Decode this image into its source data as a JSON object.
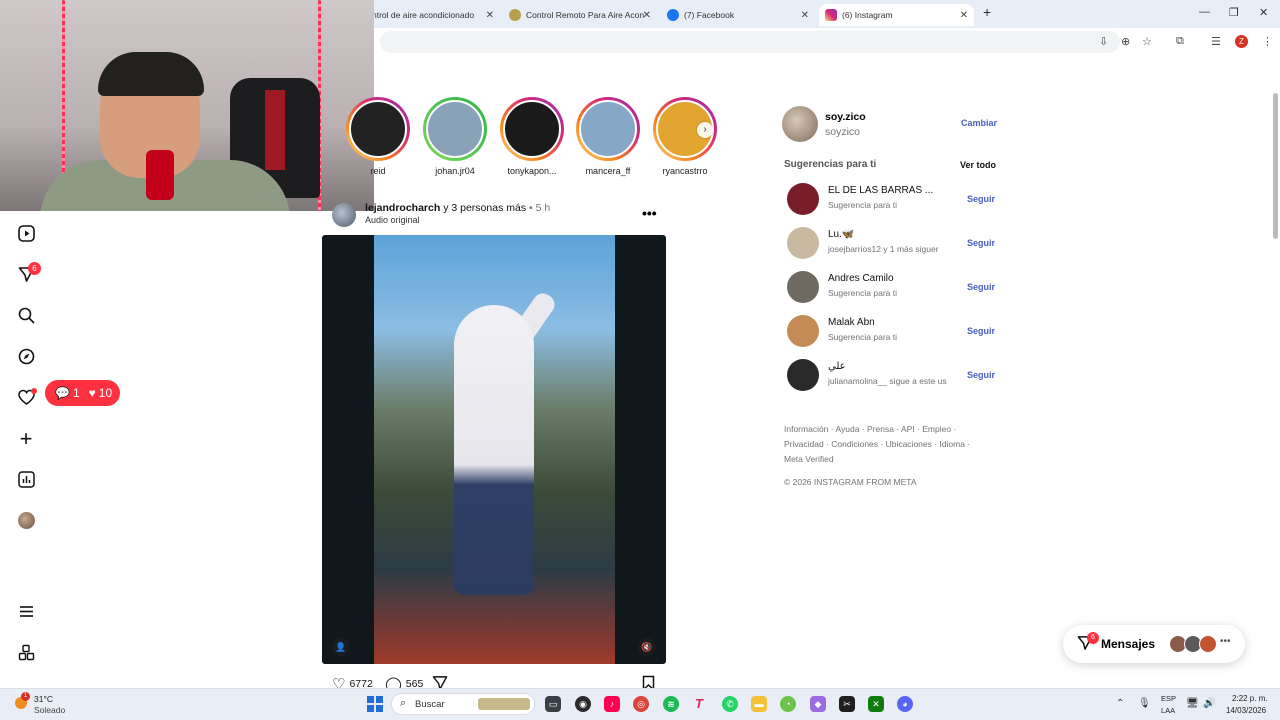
{
  "browser": {
    "tabs": [
      {
        "title": "ntrol de aire acondicionado",
        "favicon_color": "#e8eef7"
      },
      {
        "title": "Control Remoto Para Aire Acon",
        "favicon_color": "#b9a04a"
      },
      {
        "title": "(7) Facebook",
        "favicon_color": "#1877f2"
      },
      {
        "title": "(6) Instagram",
        "favicon_color": "#d62976"
      }
    ],
    "profile_initial": "Z"
  },
  "nav": {
    "messages_badge": "6",
    "notification_pill": {
      "comments": "1",
      "likes": "10"
    }
  },
  "stories": [
    {
      "name": "reid",
      "color": "#222"
    },
    {
      "name": "johan.jr04",
      "color": "#8aa2b8"
    },
    {
      "name": "tonykapon...",
      "color": "#1a1a1a"
    },
    {
      "name": "mancera_ff",
      "color": "#87a7c7"
    },
    {
      "name": "ryancastrro",
      "color": "#e2a630"
    }
  ],
  "post": {
    "user": "lejandrocharch",
    "others": "y 3 personas más",
    "time": "• 5 h",
    "audio": "Audio original",
    "likes": "6772",
    "comments": "565"
  },
  "profile": {
    "username": "soy.zico",
    "name": "soyzico",
    "switch_label": "Cambiar"
  },
  "suggestions": {
    "title": "Sugerencias para ti",
    "see_all": "Ver todo",
    "follow_label": "Seguir",
    "items": [
      {
        "name": "EL DE LAS BARRAS ...",
        "sub": "Sugerencia para ti",
        "color": "#7a1d2a"
      },
      {
        "name": "Lu.🦋",
        "sub": "josejbarrios12 y 1 más siguer",
        "color": "#c9b9a0"
      },
      {
        "name": "Andres Camilo",
        "sub": "Sugerencia para ti",
        "color": "#6e6a62"
      },
      {
        "name": "Malak Abn",
        "sub": "Sugerencia para ti",
        "color": "#c58b54"
      },
      {
        "name": "علي",
        "sub": "julianamolina__ sigue a este us",
        "color": "#2a2a2a"
      }
    ]
  },
  "footer": {
    "links": "Información · Ayuda · Prensa · API · Empleo · Privacidad · Condiciones · Ubicaciones · Idioma · Meta Verified",
    "copyright": "© 2026 INSTAGRAM FROM META"
  },
  "messages": {
    "label": "Mensajes",
    "badge": "6"
  },
  "taskbar": {
    "weather_temp": "31°C",
    "weather_desc": "Soleado",
    "weather_badge": "1",
    "search_label": "Buscar",
    "lang_line1": "ESP",
    "lang_line2": "LAA",
    "time": "2:22 p. m.",
    "date": "14/03/2026"
  }
}
